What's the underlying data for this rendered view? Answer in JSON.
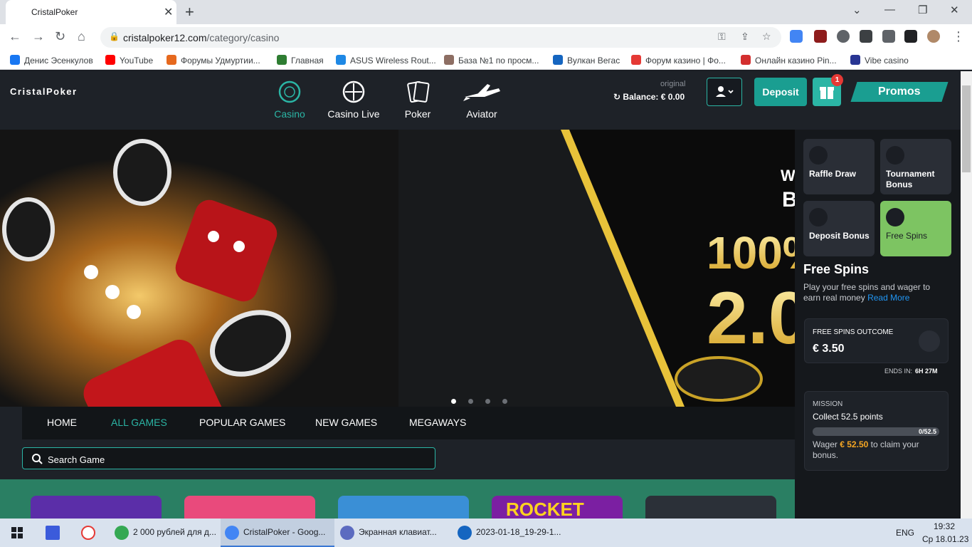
{
  "browser": {
    "tab_title": "CristalPoker",
    "url_domain": "cristalpoker12.com",
    "url_path": "/category/casino",
    "bookmarks": [
      {
        "label": "Денис Эсенкулов",
        "color": "#1877f2"
      },
      {
        "label": "YouTube",
        "color": "#ff0000"
      },
      {
        "label": "Форумы Удмуртии...",
        "color": "#e6691e"
      },
      {
        "label": "Главная",
        "color": "#2e7d32"
      },
      {
        "label": "ASUS Wireless Rout...",
        "color": "#1e88e5"
      },
      {
        "label": "База №1 по просм...",
        "color": "#8d6e63"
      },
      {
        "label": "Вулкан Вегас",
        "color": "#1565c0"
      },
      {
        "label": "Форум казино | Фо...",
        "color": "#e53935"
      },
      {
        "label": "Онлайн казино Pin...",
        "color": "#d32f2f"
      },
      {
        "label": "Vibe casino",
        "color": "#283593"
      }
    ]
  },
  "site": {
    "logo": "CristalPoker",
    "nav": [
      {
        "label": "Casino",
        "icon": "casino-chip-icon"
      },
      {
        "label": "Casino Live",
        "icon": "roulette-icon"
      },
      {
        "label": "Poker",
        "icon": "cards-icon"
      },
      {
        "label": "Aviator",
        "icon": "plane-icon"
      }
    ],
    "original_label": "original",
    "balance_text": "Balance: € 0.00",
    "deposit_label": "Deposit",
    "gift_count": "1",
    "promos_label": "Promos"
  },
  "banner": {
    "headline_partial": "100%",
    "amount_partial": "2.0",
    "corner_partial_1": "W",
    "corner_partial_2": "B",
    "slide_count": 4,
    "active_slide": 1
  },
  "categories": {
    "tabs": [
      "HOME",
      "ALL GAMES",
      "POPULAR GAMES",
      "NEW GAMES",
      "MEGAWAYS"
    ],
    "active": "ALL GAMES",
    "search_placeholder": "Search Game"
  },
  "games_partial": [
    {
      "name": "",
      "color": "#5b2ea8"
    },
    {
      "name": "",
      "color": "#e94a7c"
    },
    {
      "name": "",
      "color": "#3a8fd6"
    },
    {
      "name": "ROCKET",
      "color": "#7b1fa2"
    },
    {
      "name": "",
      "color": "#2b3038"
    },
    {
      "name": "",
      "color": "#1f4fa0"
    }
  ],
  "promo_panel": {
    "cards": [
      {
        "label": "Raffle Draw",
        "icon": "ticket-icon"
      },
      {
        "label": "Tournament Bonus",
        "icon": "trophy-icon"
      },
      {
        "label": "Deposit Bonus",
        "icon": "money-bag-icon"
      },
      {
        "label": "Free Spins",
        "icon": "slot-icon"
      }
    ],
    "active_card": "Free Spins",
    "title": "Free Spins",
    "description": "Play your free spins and wager to earn real money",
    "read_more": "Read More",
    "outcome_label": "FREE SPINS OUTCOME",
    "outcome_value": "€ 3.50",
    "ends_in_label": "ENDS IN:",
    "ends_in_value": "6H 27M",
    "mission_label": "MISSION",
    "mission_goal": "Collect 52.5 points",
    "mission_progress_text": "0/52.5",
    "mission_progress_fraction": 0,
    "wager_prefix": "Wager",
    "wager_amount": "€ 52.50",
    "wager_suffix": "to claim your bonus."
  },
  "taskbar": {
    "items": [
      {
        "label": "2 000 рублей для д...",
        "color": "#34a853"
      },
      {
        "label": "CristalPoker - Goog...",
        "color": "#4285f4"
      },
      {
        "label": "Экранная клавиат...",
        "color": "#5c6bc0"
      },
      {
        "label": "2023-01-18_19-29-1...",
        "color": "#1565c0"
      }
    ],
    "lang": "ENG",
    "time": "19:32",
    "date": "Ср 18.01.23"
  },
  "colors": {
    "accent": "#2bb5a5",
    "header_bg": "#1e2228",
    "panel_bg": "#15181c",
    "active_promo": "#7dc462",
    "wager_amount": "#f5a623"
  }
}
